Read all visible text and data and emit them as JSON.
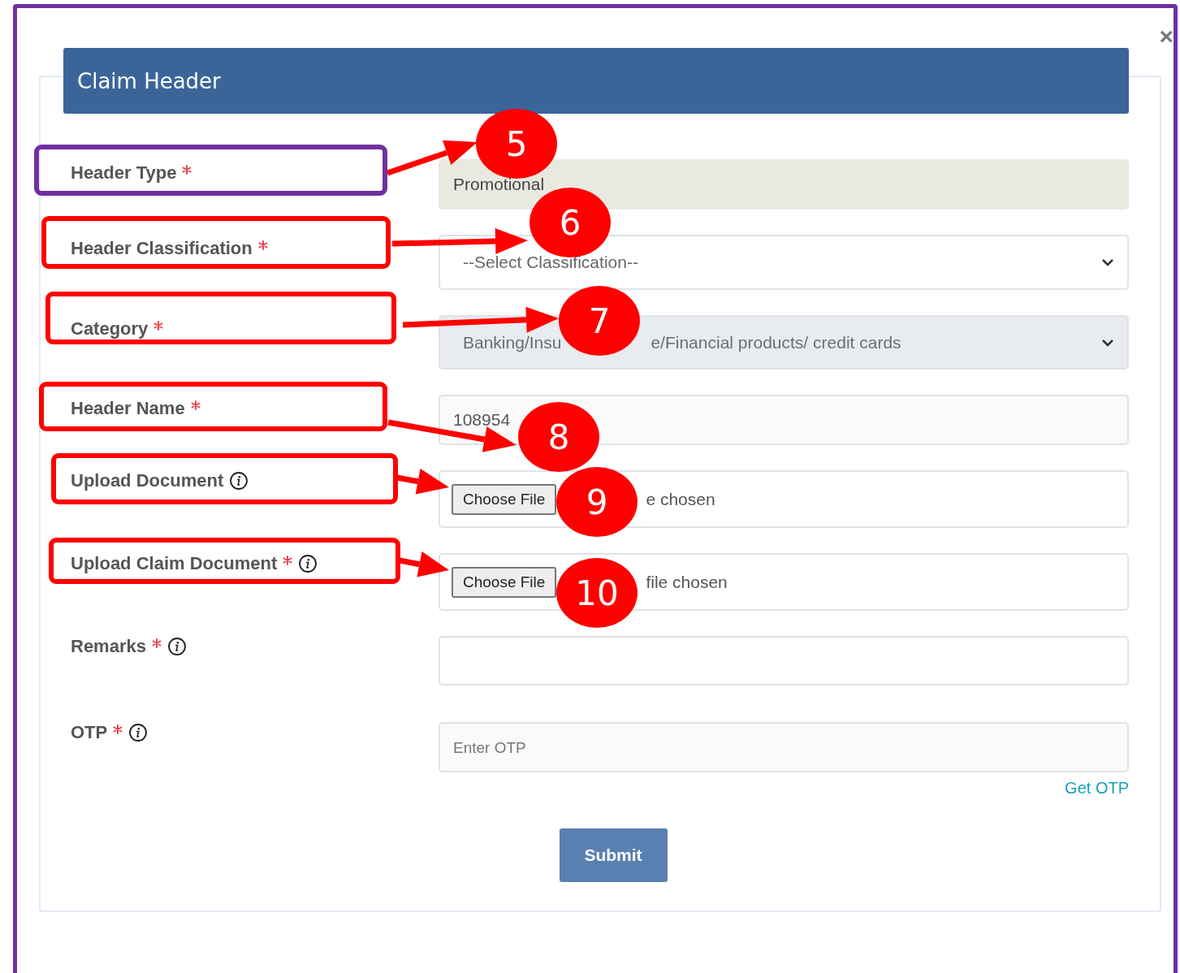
{
  "modal": {
    "close": "×",
    "title": "Claim Header"
  },
  "fields": [
    {
      "label": "Header Type",
      "required": true,
      "info": false,
      "kind": "readonly",
      "value": "Promotional"
    },
    {
      "label": "Header Classification",
      "required": true,
      "info": false,
      "kind": "select",
      "disabled": false,
      "value": [
        "--Select Classification--"
      ]
    },
    {
      "label": "Category",
      "required": true,
      "info": false,
      "kind": "select",
      "disabled": true,
      "value": [
        "Banking/Insu",
        "e/Financial products/ credit cards"
      ]
    },
    {
      "label": "Header Name",
      "required": true,
      "info": false,
      "kind": "text",
      "value": "108954"
    },
    {
      "label": "Upload Document",
      "required": false,
      "info": true,
      "kind": "file",
      "button": "Choose File",
      "status": "e chosen"
    },
    {
      "label": "Upload Claim Document",
      "required": true,
      "info": true,
      "kind": "file",
      "button": "Choose File",
      "status": "file chosen"
    },
    {
      "label": "Remarks",
      "required": true,
      "info": true,
      "kind": "text"
    },
    {
      "label": "OTP",
      "required": true,
      "info": true,
      "kind": "text",
      "placeholder": "Enter OTP",
      "link": "Get OTP"
    }
  ],
  "submit": "Submit",
  "annotations": [
    {
      "number": "5",
      "color": "#7030a0"
    },
    {
      "number": "6",
      "color": "#ff0000"
    },
    {
      "number": "7",
      "color": "#ff0000"
    },
    {
      "number": "8",
      "color": "#ff0000"
    },
    {
      "number": "9",
      "color": "#ff0000"
    },
    {
      "number": "10",
      "color": "#ff0000"
    }
  ]
}
